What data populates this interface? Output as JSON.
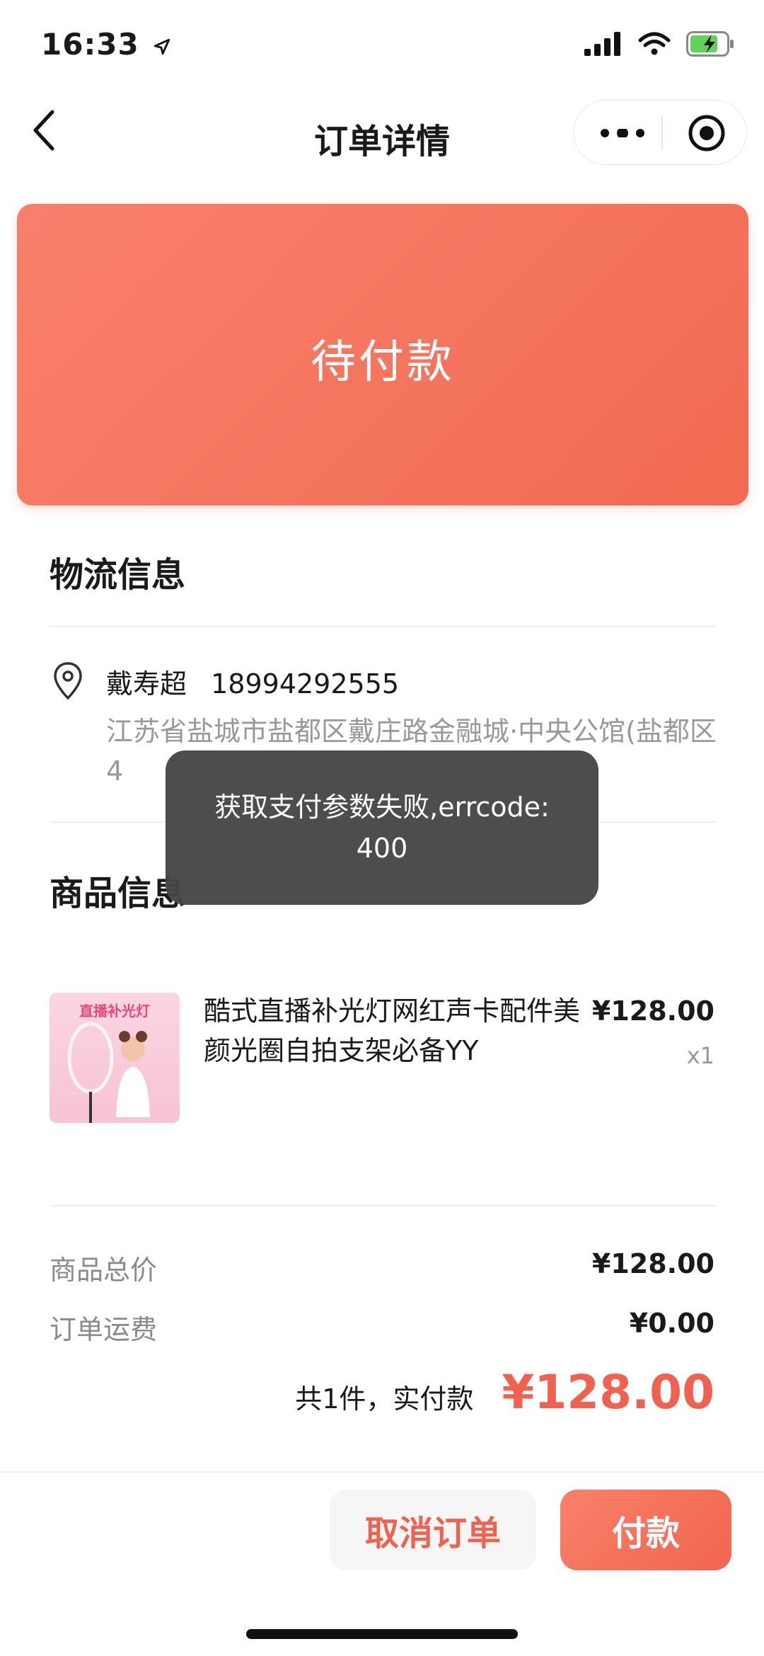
{
  "status_bar": {
    "time": "16:33"
  },
  "nav": {
    "title": "订单详情"
  },
  "banner": {
    "status": "待付款",
    "color": "#f5765f"
  },
  "logistics": {
    "title": "物流信息",
    "name": "戴寿超",
    "phone": "18994292555",
    "address": "江苏省盐城市盐都区戴庄路金融城·中央公馆(盐都区4"
  },
  "product": {
    "title": "商品信息",
    "name": "酷式直播补光灯网红声卡配件美颜光圈自拍支架必备YY",
    "price": "¥128.00",
    "quantity": "x1",
    "image_caption": "直播补光灯"
  },
  "summary": {
    "subtotal_label": "商品总价",
    "subtotal_value": "¥128.00",
    "shipping_label": "订单运费",
    "shipping_value": "¥0.00",
    "total_label": "共1件，实付款",
    "total_value": "¥128.00"
  },
  "actions": {
    "cancel": "取消订单",
    "pay": "付款"
  },
  "toast": {
    "message": "获取支付参数失败,errcode: 400"
  },
  "colors": {
    "accent": "#f0624f",
    "toast_bg": "#464646"
  }
}
